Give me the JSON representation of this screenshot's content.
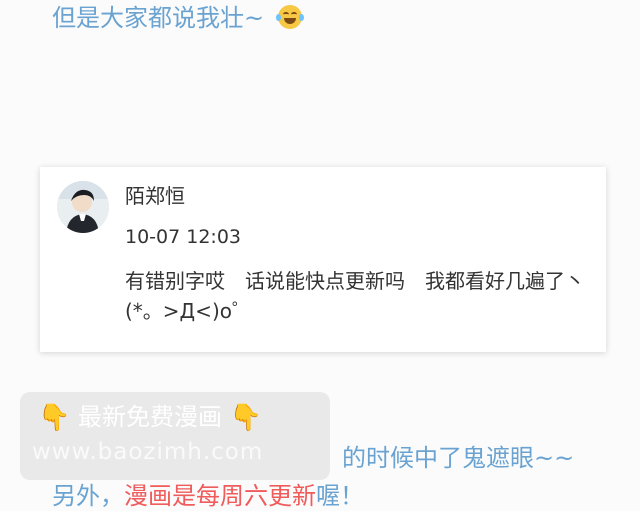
{
  "top_line": {
    "text": "但是大家都说我壮~"
  },
  "comment": {
    "username": "陌郑恒",
    "timestamp": "10-07 12:03",
    "text": "有错别字哎　话说能快点更新吗　我都看好几遍了丶(*。>Д<)o゜"
  },
  "watermark": {
    "title": "最新免费漫画",
    "site": "www.baozimh.com"
  },
  "middle_line": {
    "text": "的时候中了鬼遮眼~~"
  },
  "bottom_line": {
    "prefix": "另外，",
    "highlight": "漫画是每周六更新",
    "suffix": "喔！"
  },
  "colors": {
    "blue_text": "#6aa3d1",
    "red_text": "#f05b5b",
    "card_bg": "#ffffff",
    "page_bg": "#fbfbfb"
  },
  "icons": {
    "emoji": "laugh-cry-emoji",
    "watermark_hands": "pointing-down-hand-icon"
  }
}
